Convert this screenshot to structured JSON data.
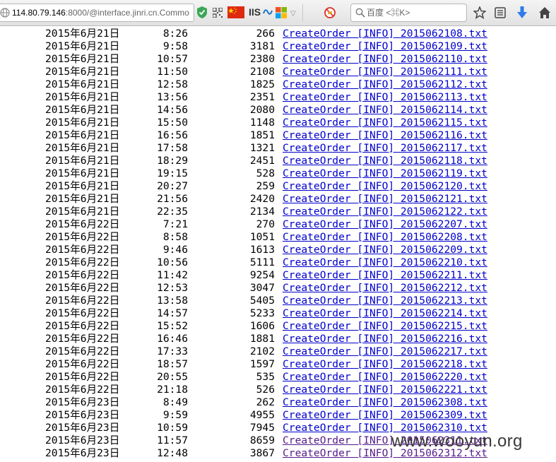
{
  "browser": {
    "url_host": "114.80.79.146",
    "url_rest": ":8000/@interface.jinri.cn.Commo",
    "iis_label": "IIS",
    "search_placeholder": "百度 <⌘K>"
  },
  "listing": [
    {
      "date": "2015年6月21日",
      "time": "8:26",
      "size": "266",
      "name": "CreateOrder [INFO] 2015062108.txt"
    },
    {
      "date": "2015年6月21日",
      "time": "9:58",
      "size": "3181",
      "name": "CreateOrder [INFO] 2015062109.txt"
    },
    {
      "date": "2015年6月21日",
      "time": "10:57",
      "size": "2380",
      "name": "CreateOrder [INFO] 2015062110.txt"
    },
    {
      "date": "2015年6月21日",
      "time": "11:50",
      "size": "2108",
      "name": "CreateOrder [INFO] 2015062111.txt"
    },
    {
      "date": "2015年6月21日",
      "time": "12:58",
      "size": "1825",
      "name": "CreateOrder [INFO] 2015062112.txt"
    },
    {
      "date": "2015年6月21日",
      "time": "13:56",
      "size": "2351",
      "name": "CreateOrder [INFO] 2015062113.txt"
    },
    {
      "date": "2015年6月21日",
      "time": "14:56",
      "size": "2080",
      "name": "CreateOrder [INFO] 2015062114.txt"
    },
    {
      "date": "2015年6月21日",
      "time": "15:50",
      "size": "1148",
      "name": "CreateOrder [INFO] 2015062115.txt"
    },
    {
      "date": "2015年6月21日",
      "time": "16:56",
      "size": "1851",
      "name": "CreateOrder [INFO] 2015062116.txt"
    },
    {
      "date": "2015年6月21日",
      "time": "17:58",
      "size": "1321",
      "name": "CreateOrder [INFO] 2015062117.txt"
    },
    {
      "date": "2015年6月21日",
      "time": "18:29",
      "size": "2451",
      "name": "CreateOrder [INFO] 2015062118.txt"
    },
    {
      "date": "2015年6月21日",
      "time": "19:15",
      "size": "528",
      "name": "CreateOrder [INFO] 2015062119.txt"
    },
    {
      "date": "2015年6月21日",
      "time": "20:27",
      "size": "259",
      "name": "CreateOrder [INFO] 2015062120.txt"
    },
    {
      "date": "2015年6月21日",
      "time": "21:56",
      "size": "2420",
      "name": "CreateOrder [INFO] 2015062121.txt"
    },
    {
      "date": "2015年6月21日",
      "time": "22:35",
      "size": "2134",
      "name": "CreateOrder [INFO] 2015062122.txt"
    },
    {
      "date": "2015年6月22日",
      "time": "7:21",
      "size": "270",
      "name": "CreateOrder [INFO] 2015062207.txt"
    },
    {
      "date": "2015年6月22日",
      "time": "8:58",
      "size": "1051",
      "name": "CreateOrder [INFO] 2015062208.txt"
    },
    {
      "date": "2015年6月22日",
      "time": "9:46",
      "size": "1613",
      "name": "CreateOrder [INFO] 2015062209.txt"
    },
    {
      "date": "2015年6月22日",
      "time": "10:56",
      "size": "5111",
      "name": "CreateOrder [INFO] 2015062210.txt"
    },
    {
      "date": "2015年6月22日",
      "time": "11:42",
      "size": "9254",
      "name": "CreateOrder [INFO] 2015062211.txt"
    },
    {
      "date": "2015年6月22日",
      "time": "12:53",
      "size": "3047",
      "name": "CreateOrder [INFO] 2015062212.txt"
    },
    {
      "date": "2015年6月22日",
      "time": "13:58",
      "size": "5405",
      "name": "CreateOrder [INFO] 2015062213.txt"
    },
    {
      "date": "2015年6月22日",
      "time": "14:57",
      "size": "5233",
      "name": "CreateOrder [INFO] 2015062214.txt"
    },
    {
      "date": "2015年6月22日",
      "time": "15:52",
      "size": "1606",
      "name": "CreateOrder [INFO] 2015062215.txt"
    },
    {
      "date": "2015年6月22日",
      "time": "16:46",
      "size": "1881",
      "name": "CreateOrder [INFO] 2015062216.txt"
    },
    {
      "date": "2015年6月22日",
      "time": "17:33",
      "size": "2102",
      "name": "CreateOrder [INFO] 2015062217.txt"
    },
    {
      "date": "2015年6月22日",
      "time": "18:57",
      "size": "1597",
      "name": "CreateOrder [INFO] 2015062218.txt"
    },
    {
      "date": "2015年6月22日",
      "time": "20:55",
      "size": "535",
      "name": "CreateOrder [INFO] 2015062220.txt"
    },
    {
      "date": "2015年6月22日",
      "time": "21:18",
      "size": "526",
      "name": "CreateOrder [INFO] 2015062221.txt"
    },
    {
      "date": "2015年6月23日",
      "time": "8:49",
      "size": "262",
      "name": "CreateOrder [INFO] 2015062308.txt"
    },
    {
      "date": "2015年6月23日",
      "time": "9:59",
      "size": "4955",
      "name": "CreateOrder [INFO] 2015062309.txt"
    },
    {
      "date": "2015年6月23日",
      "time": "10:59",
      "size": "7945",
      "name": "CreateOrder [INFO] 2015062310.txt"
    },
    {
      "date": "2015年6月23日",
      "time": "11:57",
      "size": "8659",
      "name": "CreateOrder [INFO] 2015062311.txt",
      "visited": true
    },
    {
      "date": "2015年6月23日",
      "time": "12:48",
      "size": "3867",
      "name": "CreateOrder [INFO] 2015062312.txt",
      "visited": true
    }
  ],
  "watermark": "www.wooyun.org",
  "colors": {
    "link": "#0000cc",
    "visited": "#551a8b",
    "flag": "#de2910"
  }
}
